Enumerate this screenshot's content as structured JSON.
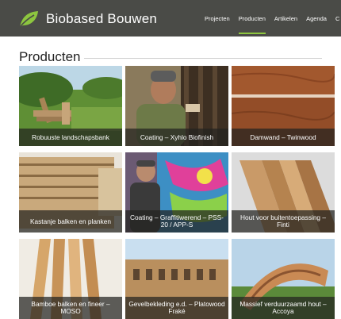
{
  "header": {
    "brand": "Biobased Bouwen",
    "nav": [
      {
        "label": "Projecten"
      },
      {
        "label": "Producten"
      },
      {
        "label": "Artikelen"
      },
      {
        "label": "Agenda"
      },
      {
        "label": "C"
      }
    ],
    "active_nav": "Producten",
    "accent_color": "#8dc63f",
    "bar_color": "#4a4b47",
    "logo_icon": "leaf-icon"
  },
  "main": {
    "title": "Producten",
    "products": [
      {
        "title": "Robuuste landschapsbank"
      },
      {
        "title": "Coating – Xyhlo Biofinish"
      },
      {
        "title": "Damwand – Twinwood"
      },
      {
        "title": "Kastanje balken en planken"
      },
      {
        "title": "Coating – Graffitiwerend – PSS-20 / APP-S"
      },
      {
        "title": "Hout voor buitentoepassing – Finti"
      },
      {
        "title": "Bamboe balken en fineer – MOSO"
      },
      {
        "title": "Gevelbekleding e.d. – Platowood Fraké"
      },
      {
        "title": "Massief verduurzaamd hout – Accoya"
      }
    ]
  }
}
